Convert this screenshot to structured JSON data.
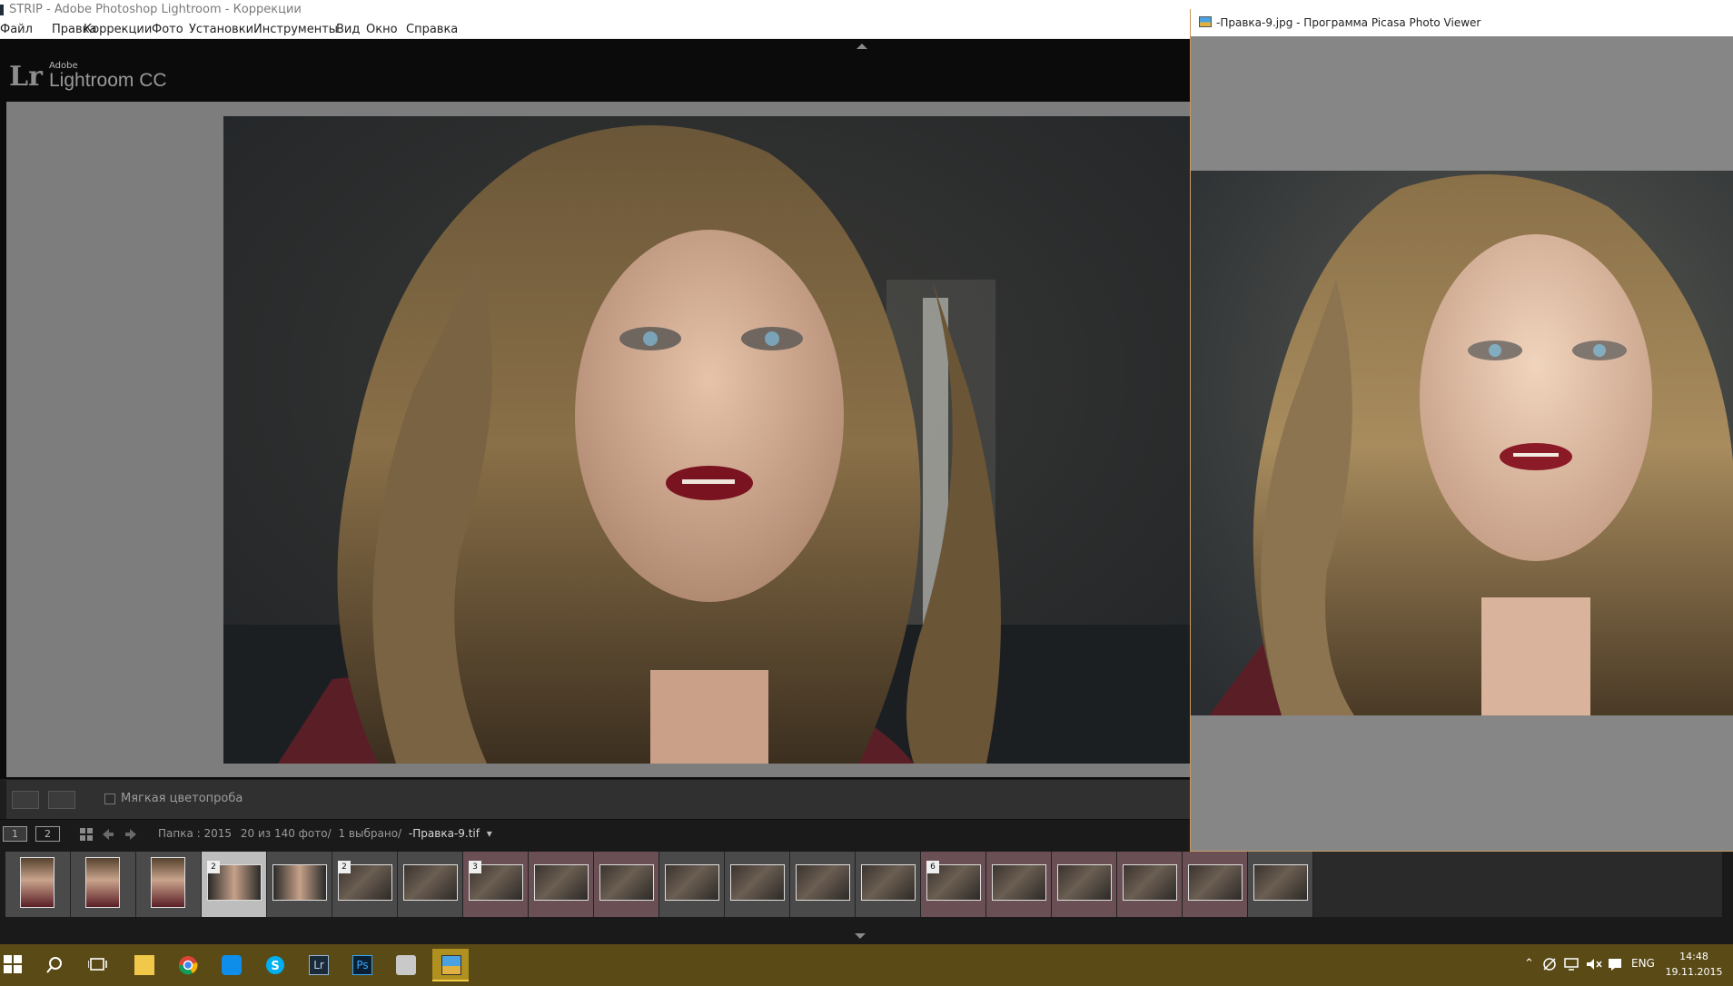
{
  "lightroom": {
    "title": "STRIP - Adobe Photoshop Lightroom - Коррекции",
    "menu": [
      "Файл",
      "Правка",
      "Коррекции",
      "Фото",
      "Установки",
      "Инструменты",
      "Вид",
      "Окно",
      "Справка"
    ],
    "logo_mark": "Lr",
    "brand_small": "Adobe",
    "product": "Lightroom CC",
    "toolbar": {
      "soft_proof_label": "Мягкая цветопроба",
      "soft_proof_checked": false
    },
    "filmstrip_nav": {
      "monitor_1": "1",
      "monitor_2": "2",
      "folder_label": "Папка : 2015",
      "count": "20 из 140 фото/",
      "selected": "1 выбрано/",
      "filename": "-Правка-9.tif"
    },
    "filmstrip": {
      "stack_badges": [
        "2",
        "2",
        "3",
        "6"
      ]
    }
  },
  "picasa": {
    "title": "-Правка-9.jpg - Программа Picasa Photo Viewer"
  },
  "taskbar": {
    "apps": [
      "start-icon",
      "search-icon",
      "task-view-icon",
      "file-explorer-icon",
      "chrome-icon",
      "teamviewer-icon",
      "skype-icon",
      "lightroom-icon",
      "photoshop-icon",
      "printer-icon",
      "picasa-photo-viewer-icon"
    ],
    "lightroom_glyph": "Lr",
    "photoshop_glyph": "Ps",
    "language": "ENG",
    "time": "14:48",
    "date": "19.11.2015",
    "accent": "#b0901f"
  }
}
